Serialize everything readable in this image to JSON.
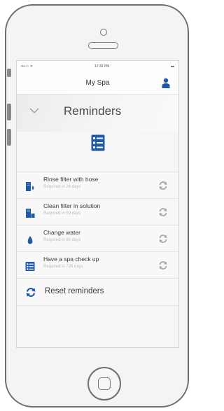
{
  "statusbar": {
    "carrier": "•••○○ ᯤ",
    "time": "12:39 PM",
    "battery": "▬"
  },
  "navbar": {
    "title": "My Spa",
    "user_icon": "user-icon"
  },
  "header": {
    "title": "Reminders",
    "collapse_icon": "chevron-down-icon",
    "list_icon": "list-icon"
  },
  "reminders": [
    {
      "title": "Rinse filter with hose",
      "subtitle": "Required in 26 days",
      "icon": "filter-drop-icon"
    },
    {
      "title": "Clean filter in solution",
      "subtitle": "Required in 59 days",
      "icon": "filter-clean-icon"
    },
    {
      "title": "Change water",
      "subtitle": "Required in 80 days",
      "icon": "water-drop-icon"
    },
    {
      "title": "Have a spa check up",
      "subtitle": "Required in 729 days",
      "icon": "checklist-icon"
    }
  ],
  "reset": {
    "label": "Reset reminders",
    "icon": "reset-icon"
  },
  "colors": {
    "accent": "#1e5aa8",
    "muted_icon": "#a8a8a8"
  }
}
